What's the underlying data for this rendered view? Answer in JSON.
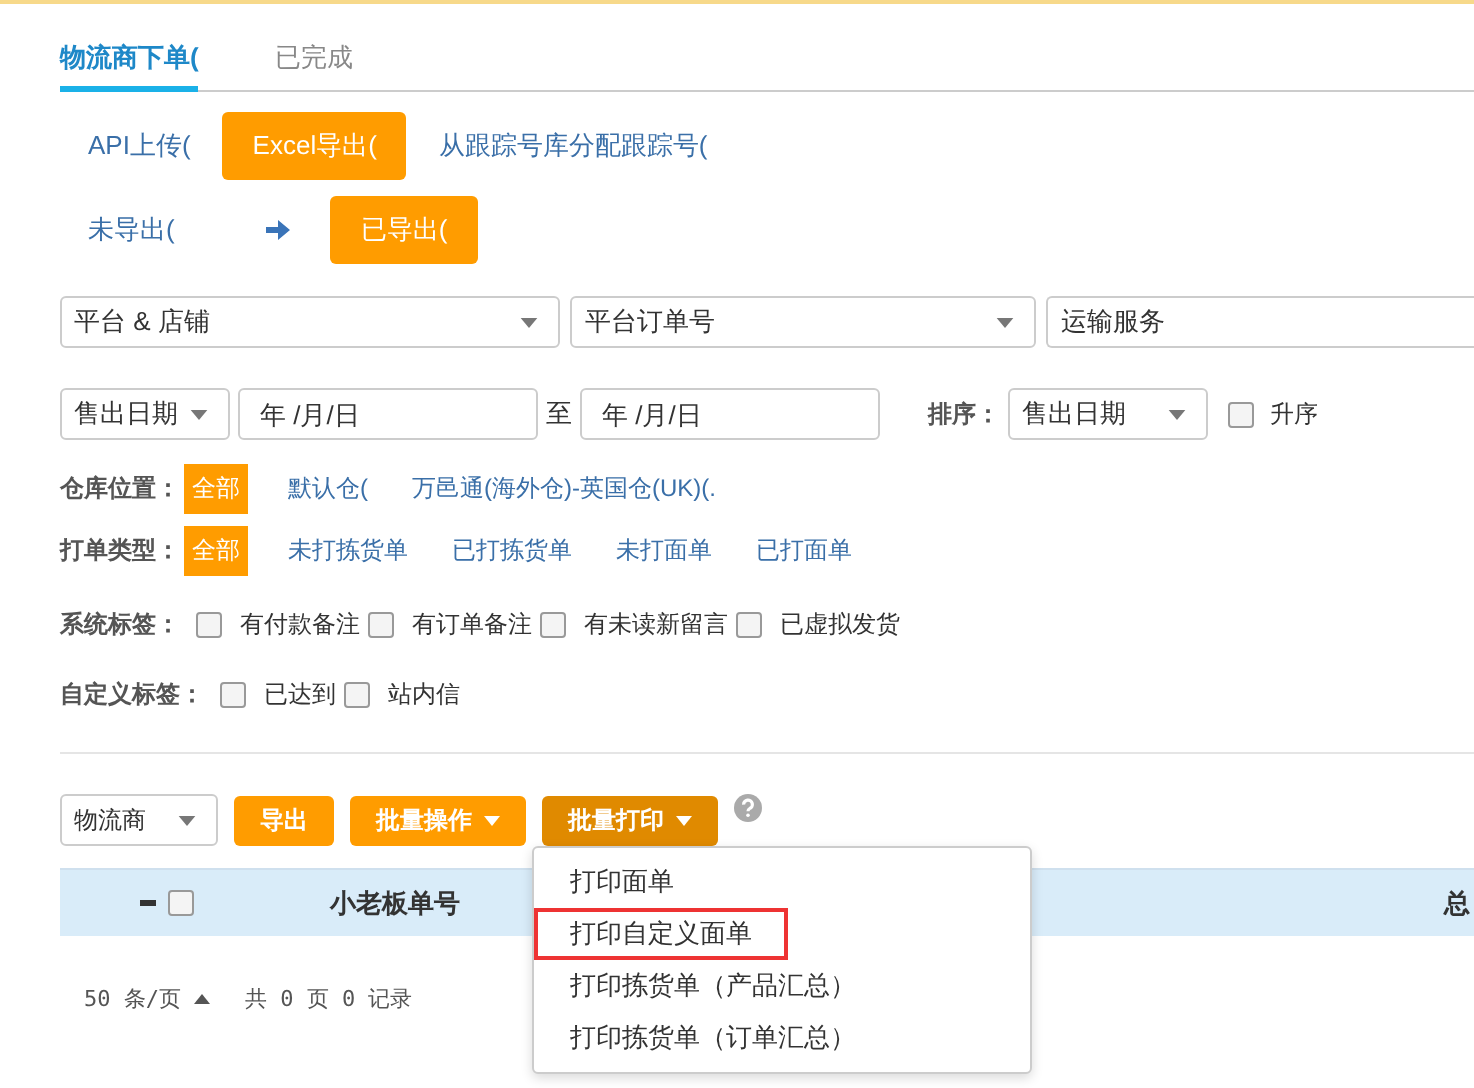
{
  "tabs": [
    {
      "label": "物流商下单(",
      "selected": true
    },
    {
      "label": "已完成",
      "selected": false
    }
  ],
  "export_filters": [
    {
      "label": "API上传(",
      "selected": false
    },
    {
      "label": "Excel导出(",
      "selected": true
    },
    {
      "label": "从跟踪号库分配跟踪号(",
      "selected": false
    }
  ],
  "export_status": [
    {
      "label": "未导出(",
      "selected": false
    },
    {
      "label": "已导出(",
      "selected": true
    }
  ],
  "search_row": [
    {
      "value": "平台 & 店铺",
      "kind": "select"
    },
    {
      "value": "平台订单号",
      "kind": "select"
    },
    {
      "value": "运输服务",
      "kind": "input"
    }
  ],
  "date_filter": {
    "date_type": "售出日期",
    "from_placeholder": "年 /月/日",
    "separator": "至",
    "to_placeholder": "年 /月/日",
    "sort_label": "排序：",
    "sort_field": "售出日期",
    "ascending_label": "升序",
    "ascending": false
  },
  "warehouse": {
    "label": "仓库位置：",
    "options": [
      {
        "label": "全部",
        "selected": true
      },
      {
        "label": "默认仓(",
        "selected": false
      },
      {
        "label": "万邑通(海外仓)-英国仓(UK)(.",
        "selected": false
      }
    ]
  },
  "print_type": {
    "label": "打单类型：",
    "options": [
      {
        "label": "全部",
        "selected": true
      },
      {
        "label": "未打拣货单",
        "selected": false
      },
      {
        "label": "已打拣货单",
        "selected": false
      },
      {
        "label": "未打面单",
        "selected": false
      },
      {
        "label": "已打面单",
        "selected": false
      }
    ]
  },
  "system_tags": {
    "label": "系统标签：",
    "options": [
      {
        "label": "有付款备注",
        "checked": false
      },
      {
        "label": "有订单备注",
        "checked": false
      },
      {
        "label": "有未读新留言",
        "checked": false
      },
      {
        "label": "已虚拟发货",
        "checked": false
      }
    ]
  },
  "custom_tags": {
    "label": "自定义标签：",
    "options": [
      {
        "label": "已达到",
        "checked": false
      },
      {
        "label": "站内信",
        "checked": false
      }
    ]
  },
  "toolbar": {
    "carrier_select": "物流商",
    "buttons": [
      {
        "label": "导出",
        "dropdown": false,
        "active": false
      },
      {
        "label": "批量操作",
        "dropdown": true,
        "active": false
      },
      {
        "label": "批量打印",
        "dropdown": true,
        "active": true
      }
    ]
  },
  "table": {
    "columns": [
      "小老板单号",
      "总"
    ],
    "select_all": false
  },
  "pagination": {
    "page_size": "50 条/页",
    "summary": "共 0 页 0 记录"
  },
  "print_menu": {
    "items": [
      {
        "label": "打印面单",
        "highlighted": false
      },
      {
        "label": "打印自定义面单",
        "highlighted": true
      },
      {
        "label": "打印拣货单（产品汇总）",
        "highlighted": false
      },
      {
        "label": "打印拣货单（订单汇总）",
        "highlighted": false
      }
    ]
  }
}
